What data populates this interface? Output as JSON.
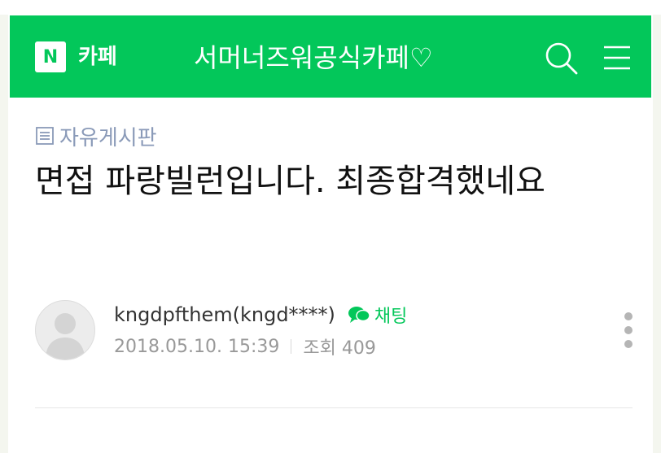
{
  "header": {
    "logo_letter": "N",
    "logo_text": "카페",
    "cafe_name": "서머너즈워공식카페♡",
    "brand_color": "#03c75a"
  },
  "board": {
    "name": "자유게시판"
  },
  "post": {
    "title": "면접 파랑빌런입니다. 최종합격했네요",
    "author": "kngdpfthem(kngd****)",
    "chat_label": "채팅",
    "date": "2018.05.10. 15:39",
    "views_label": "조회 409"
  },
  "icons": {
    "search": "search-icon",
    "menu": "hamburger-menu-icon",
    "board": "board-list-icon",
    "chat": "chat-bubble-icon",
    "more": "more-vertical-icon",
    "avatar": "default-avatar-icon"
  }
}
